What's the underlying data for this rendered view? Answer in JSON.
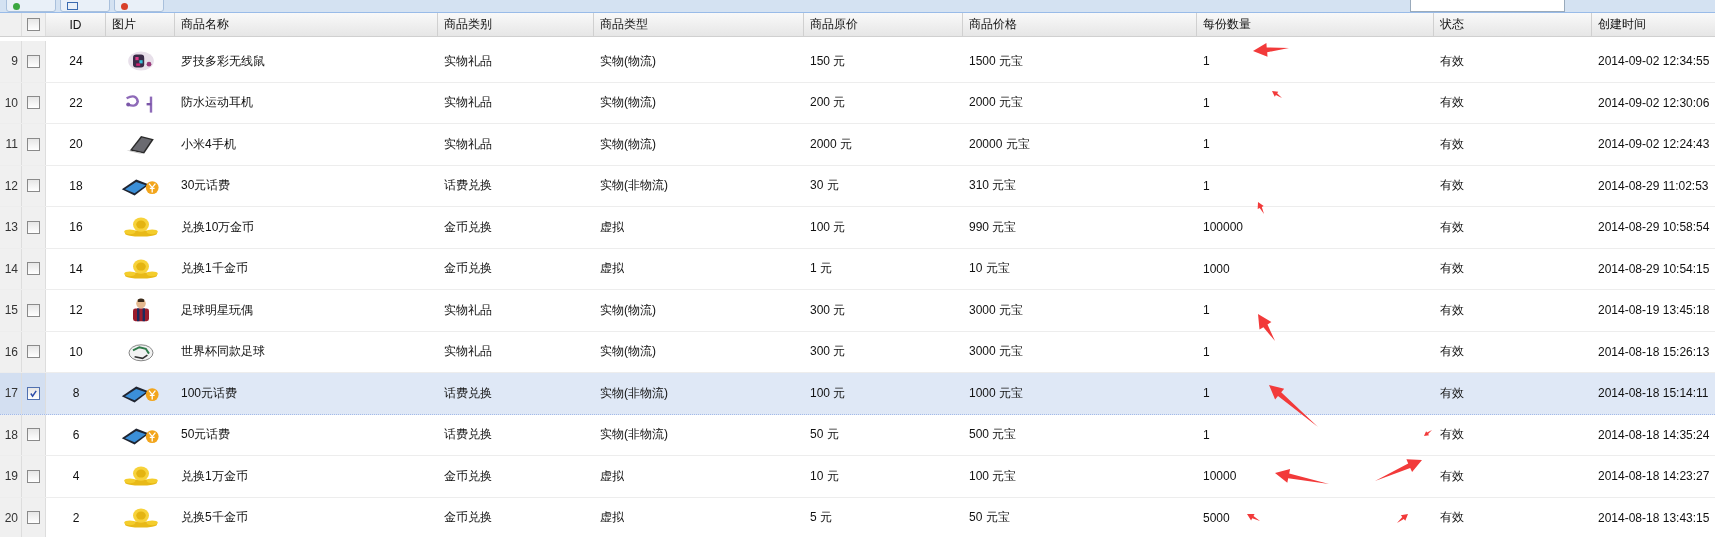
{
  "columns": [
    "ID",
    "图片",
    "商品名称",
    "商品类别",
    "商品类型",
    "商品原价",
    "商品价格",
    "每份数量",
    "状态",
    "创建时间"
  ],
  "header_checked": false,
  "rows": [
    {
      "row_number": "9",
      "selected": false,
      "id": "24",
      "kind": "mouse",
      "name": "罗技多彩无线鼠",
      "category": "实物礼品",
      "type": "实物(物流)",
      "original_price": "150 元",
      "price": "1500 元宝",
      "quantity": "1",
      "status": "有效",
      "created": "2014-09-02 12:34:55"
    },
    {
      "row_number": "10",
      "selected": false,
      "id": "22",
      "kind": "earphones",
      "name": "防水运动耳机",
      "category": "实物礼品",
      "type": "实物(物流)",
      "original_price": "200 元",
      "price": "2000 元宝",
      "quantity": "1",
      "status": "有效",
      "created": "2014-09-02 12:30:06"
    },
    {
      "row_number": "11",
      "selected": false,
      "id": "20",
      "kind": "tablet",
      "name": "小米4手机",
      "category": "实物礼品",
      "type": "实物(物流)",
      "original_price": "2000 元",
      "price": "20000 元宝",
      "quantity": "1",
      "status": "有效",
      "created": "2014-09-02 12:24:43"
    },
    {
      "row_number": "12",
      "selected": false,
      "id": "18",
      "kind": "phone-card",
      "name": "30元话费",
      "category": "话费兑换",
      "type": "实物(非物流)",
      "original_price": "30 元",
      "price": "310 元宝",
      "quantity": "1",
      "status": "有效",
      "created": "2014-08-29 11:02:53"
    },
    {
      "row_number": "13",
      "selected": false,
      "id": "16",
      "kind": "coins",
      "name": "兑换10万金币",
      "category": "金币兑换",
      "type": "虚拟",
      "original_price": "100 元",
      "price": "990 元宝",
      "quantity": "100000",
      "status": "有效",
      "created": "2014-08-29 10:58:54"
    },
    {
      "row_number": "14",
      "selected": false,
      "id": "14",
      "kind": "coins",
      "name": "兑换1千金币",
      "category": "金币兑换",
      "type": "虚拟",
      "original_price": "1 元",
      "price": "10 元宝",
      "quantity": "1000",
      "status": "有效",
      "created": "2014-08-29 10:54:15"
    },
    {
      "row_number": "15",
      "selected": false,
      "id": "12",
      "kind": "figure",
      "name": "足球明星玩偶",
      "category": "实物礼品",
      "type": "实物(物流)",
      "original_price": "300 元",
      "price": "3000 元宝",
      "quantity": "1",
      "status": "有效",
      "created": "2014-08-19 13:45:18"
    },
    {
      "row_number": "16",
      "selected": false,
      "id": "10",
      "kind": "ball",
      "name": "世界杯同款足球",
      "category": "实物礼品",
      "type": "实物(物流)",
      "original_price": "300 元",
      "price": "3000 元宝",
      "quantity": "1",
      "status": "有效",
      "created": "2014-08-18 15:26:13"
    },
    {
      "row_number": "17",
      "selected": true,
      "id": "8",
      "kind": "phone-card",
      "name": "100元话费",
      "category": "话费兑换",
      "type": "实物(非物流)",
      "original_price": "100 元",
      "price": "1000 元宝",
      "quantity": "1",
      "status": "有效",
      "created": "2014-08-18 15:14:11"
    },
    {
      "row_number": "18",
      "selected": false,
      "id": "6",
      "kind": "phone-card",
      "name": "50元话费",
      "category": "话费兑换",
      "type": "实物(非物流)",
      "original_price": "50 元",
      "price": "500 元宝",
      "quantity": "1",
      "status": "有效",
      "created": "2014-08-18 14:35:24"
    },
    {
      "row_number": "19",
      "selected": false,
      "id": "4",
      "kind": "coins",
      "name": "兑换1万金币",
      "category": "金币兑换",
      "type": "虚拟",
      "original_price": "10 元",
      "price": "100 元宝",
      "quantity": "10000",
      "status": "有效",
      "created": "2014-08-18 14:23:27"
    },
    {
      "row_number": "20",
      "selected": false,
      "id": "2",
      "kind": "coins",
      "name": "兑换5千金币",
      "category": "金币兑换",
      "type": "虚拟",
      "original_price": "5 元",
      "price": "50 元宝",
      "quantity": "5000",
      "status": "有效",
      "created": "2014-08-18 13:43:15"
    }
  ]
}
